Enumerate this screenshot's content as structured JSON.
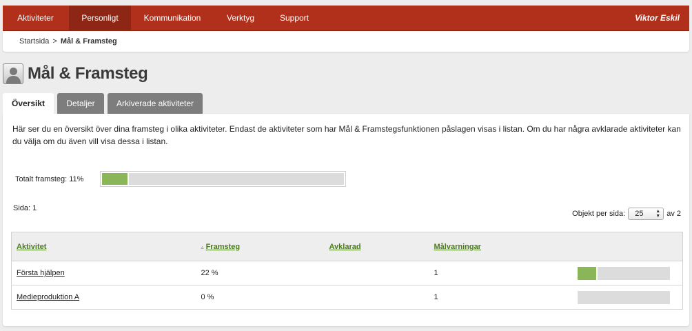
{
  "nav": {
    "items": [
      {
        "label": "Aktiviteter"
      },
      {
        "label": "Personligt"
      },
      {
        "label": "Kommunikation"
      },
      {
        "label": "Verktyg"
      },
      {
        "label": "Support"
      }
    ],
    "active_index": 1,
    "user_name": "Viktor Eskil"
  },
  "breadcrumb": {
    "home": "Startsida",
    "separator": ">",
    "current": "Mål & Framsteg"
  },
  "page": {
    "title": "Mål & Framsteg",
    "icon": "user-avatar-icon"
  },
  "tabs": [
    {
      "label": "Översikt",
      "active": true
    },
    {
      "label": "Detaljer",
      "active": false
    },
    {
      "label": "Arkiverade aktiviteter",
      "active": false
    }
  ],
  "intro_text": "Här ser du en översikt över dina framsteg i olika aktiviteter. Endast de aktiviteter som har Mål & Framstegsfunktionen påslagen visas i listan. Om du har några avklarade aktiviteter kan du välja om du även vill visa dessa i listan.",
  "total_progress": {
    "label": "Totalt framsteg: 11%",
    "percent": 11
  },
  "pagination": {
    "page_label": "Sida: 1",
    "per_page_label": "Objekt per sida:",
    "per_page_value": "25",
    "of_label": "av 2"
  },
  "table": {
    "headers": {
      "activity": "Aktivitet",
      "progress": "Framsteg",
      "completed": "Avklarad",
      "warnings": "Målvarningar"
    },
    "rows": [
      {
        "activity": "Första hjälpen",
        "progress": "22 %",
        "completed": "",
        "warnings": "1",
        "percent": 22
      },
      {
        "activity": "Medieproduktion A",
        "progress": "0 %",
        "completed": "",
        "warnings": "1",
        "percent": 0
      }
    ]
  },
  "colors": {
    "nav_bg": "#b1301b",
    "nav_active": "#8d2614",
    "progress_fill": "#8ab658",
    "link_green": "#4b7b1f"
  }
}
